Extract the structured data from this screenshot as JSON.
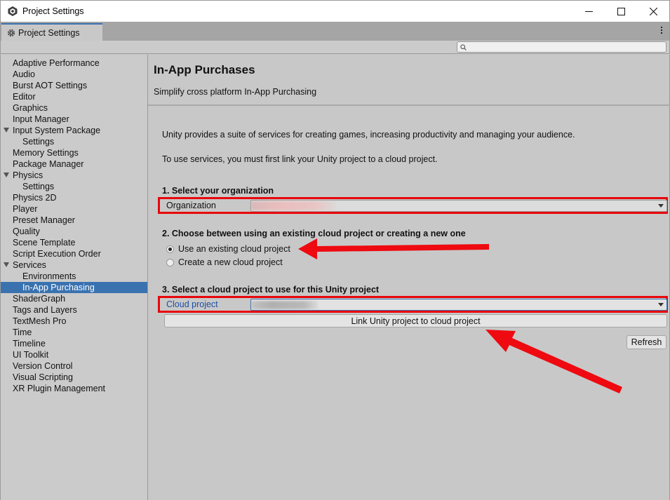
{
  "window": {
    "title": "Project Settings"
  },
  "tab": {
    "label": "Project Settings"
  },
  "search": {
    "placeholder": ""
  },
  "sidebar": {
    "items": [
      {
        "label": "Adaptive Performance"
      },
      {
        "label": "Audio"
      },
      {
        "label": "Burst AOT Settings"
      },
      {
        "label": "Editor"
      },
      {
        "label": "Graphics"
      },
      {
        "label": "Input Manager"
      },
      {
        "label": "Input System Package"
      },
      {
        "label": "Settings"
      },
      {
        "label": "Memory Settings"
      },
      {
        "label": "Package Manager"
      },
      {
        "label": "Physics"
      },
      {
        "label": "Settings"
      },
      {
        "label": "Physics 2D"
      },
      {
        "label": "Player"
      },
      {
        "label": "Preset Manager"
      },
      {
        "label": "Quality"
      },
      {
        "label": "Scene Template"
      },
      {
        "label": "Script Execution Order"
      },
      {
        "label": "Services"
      },
      {
        "label": "Environments"
      },
      {
        "label": "In-App Purchasing"
      },
      {
        "label": "ShaderGraph"
      },
      {
        "label": "Tags and Layers"
      },
      {
        "label": "TextMesh Pro"
      },
      {
        "label": "Time"
      },
      {
        "label": "Timeline"
      },
      {
        "label": "UI Toolkit"
      },
      {
        "label": "Version Control"
      },
      {
        "label": "Visual Scripting"
      },
      {
        "label": "XR Plugin Management"
      }
    ]
  },
  "main": {
    "title": "In-App Purchases",
    "subtitle": "Simplify cross platform In-App Purchasing",
    "intro1": "Unity provides a suite of services for creating games, increasing productivity and managing your audience.",
    "intro2": "To use services, you must first link your Unity project to a cloud project.",
    "step1": {
      "heading": "1. Select your organization",
      "field_label": "Organization"
    },
    "step2": {
      "heading": "2. Choose between using an existing cloud project or creating a new one",
      "option_existing": "Use an existing cloud project",
      "option_new": "Create a new cloud project",
      "selected": "existing"
    },
    "step3": {
      "heading": "3. Select a cloud project to use for this Unity project",
      "field_label": "Cloud project",
      "link_button": "Link Unity project to cloud project"
    },
    "refresh_button": "Refresh"
  },
  "colors": {
    "selection": "#3a72b0",
    "highlight": "#e8070b",
    "field_label_blue": "#1c4fa6"
  }
}
